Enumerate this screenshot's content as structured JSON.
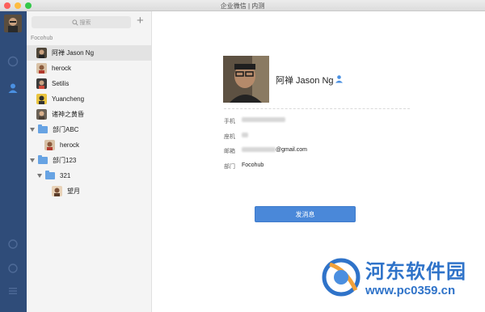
{
  "window": {
    "title": "企业微信 | 内测"
  },
  "sidebar": {
    "search_placeholder": "搜索",
    "add_label": "+",
    "group_label": "Focohub",
    "contacts": [
      {
        "name": "阿禅 Jason Ng",
        "selected": true
      },
      {
        "name": "herock"
      },
      {
        "name": "Setilis"
      },
      {
        "name": "Yuancheng"
      },
      {
        "name": "诸神之黄昏"
      }
    ],
    "departments": [
      {
        "name": "部门ABC",
        "members": [
          {
            "name": "herock"
          }
        ]
      },
      {
        "name": "部门123",
        "subdepartments": [
          {
            "name": "321",
            "members": [
              {
                "name": "望月"
              }
            ]
          }
        ]
      }
    ]
  },
  "profile": {
    "name": "阿禅 Jason Ng",
    "fields": {
      "mobile_label": "手机",
      "phone_label": "座机",
      "email_label": "邮箱",
      "email_suffix": "@gmail.com",
      "department_label": "部门",
      "department_value": "Focohub"
    },
    "send_button": "发消息"
  },
  "watermark": {
    "line1": "河东软件园",
    "line2": "www.pc0359.cn"
  },
  "colors": {
    "nav": "#2f4c79",
    "accent": "#4a88d9",
    "watermark": "#2f73c9"
  }
}
